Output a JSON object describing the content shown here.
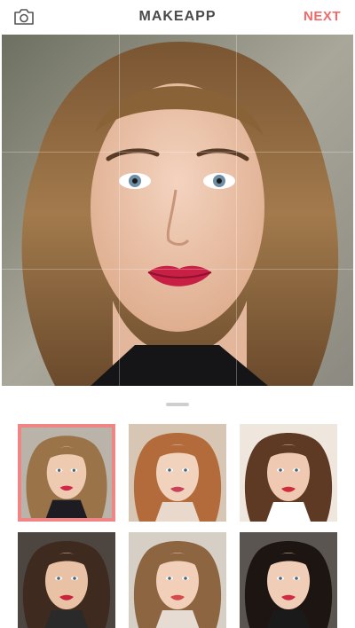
{
  "header": {
    "title": "MAKEAPP",
    "next_label": "NEXT",
    "camera_icon": "camera-icon",
    "accent_color": "#f06a6a"
  },
  "preview": {
    "grid": "rule-of-thirds",
    "show_grid": true
  },
  "gallery": {
    "selected_index": 0,
    "selection_color": "#f08585",
    "photos": [
      {
        "hair": "#9a7448",
        "skin": "#eecab0",
        "bg": "#b9b3aa",
        "lips": "#d2274a",
        "top": "#1c1c22"
      },
      {
        "hair": "#b36b3c",
        "skin": "#f1d2bd",
        "bg": "#d8c6b4",
        "lips": "#c7425a",
        "top": "#e9d9cc"
      },
      {
        "hair": "#5e3a24",
        "skin": "#f0c9b3",
        "bg": "#efe7dd",
        "lips": "#d02c3a",
        "top": "#ffffff"
      },
      {
        "hair": "#3e2a1f",
        "skin": "#e9c2a6",
        "bg": "#4d4640",
        "lips": "#c9233b",
        "top": "#2a2a2a"
      },
      {
        "hair": "#8e6541",
        "skin": "#f2cfb8",
        "bg": "#d6cfc6",
        "lips": "#d54a4a",
        "top": "#e6dcd3"
      },
      {
        "hair": "#1d1512",
        "skin": "#efcdb7",
        "bg": "#5b5552",
        "lips": "#d02a45",
        "top": "#1a1a1a"
      }
    ]
  }
}
